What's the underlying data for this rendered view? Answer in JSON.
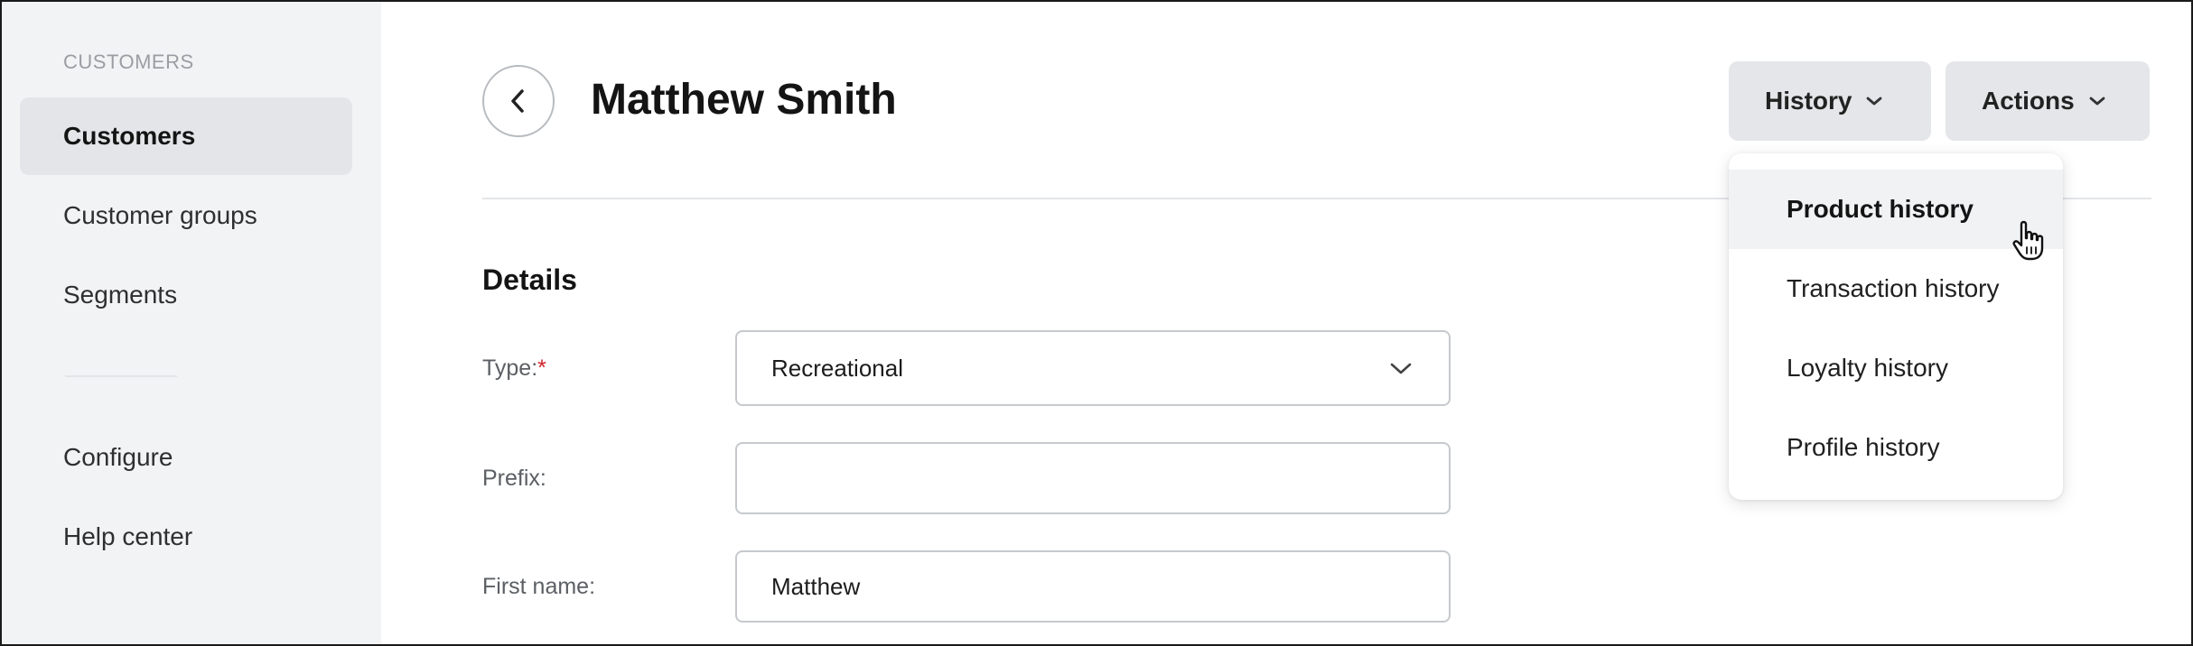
{
  "sidebar": {
    "heading": "CUSTOMERS",
    "items": [
      {
        "label": "Customers",
        "active": true
      },
      {
        "label": "Customer groups",
        "active": false
      },
      {
        "label": "Segments",
        "active": false
      }
    ],
    "bottom_items": [
      {
        "label": "Configure"
      },
      {
        "label": "Help center"
      }
    ]
  },
  "header": {
    "title": "Matthew Smith",
    "back_icon": "chevron-left-icon",
    "history_label": "History",
    "actions_label": "Actions"
  },
  "history_menu": {
    "items": [
      {
        "label": "Product history",
        "hovered": true
      },
      {
        "label": "Transaction history"
      },
      {
        "label": "Loyalty history"
      },
      {
        "label": "Profile history"
      }
    ]
  },
  "details": {
    "section_title": "Details",
    "type": {
      "label": "Type:",
      "required_mark": "*",
      "value": "Recreational"
    },
    "prefix": {
      "label": "Prefix:",
      "value": ""
    },
    "first_name": {
      "label": "First name:",
      "value": "Matthew"
    }
  },
  "colors": {
    "sidebar_bg": "#f2f3f4",
    "active_item_bg": "#e3e5e8",
    "button_bg": "#e4e6e9",
    "required": "#d0222a"
  }
}
